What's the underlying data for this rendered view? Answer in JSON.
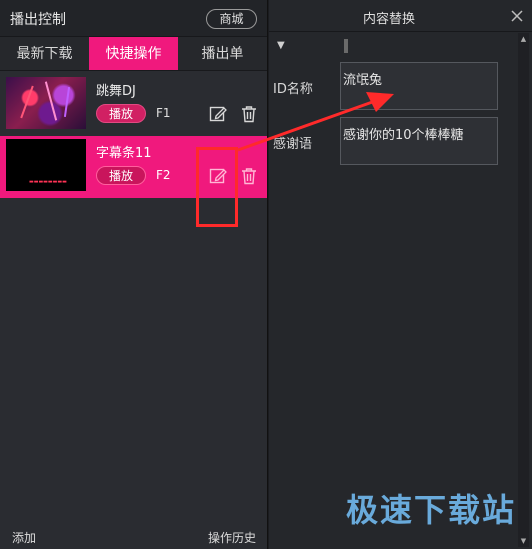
{
  "left_panel": {
    "title": "播出控制",
    "shop_label": "商城",
    "tabs": [
      {
        "label": "最新下载",
        "active": false
      },
      {
        "label": "快捷操作",
        "active": true
      },
      {
        "label": "播出单",
        "active": false
      }
    ],
    "items": [
      {
        "name": "跳舞DJ",
        "play_label": "播放",
        "hotkey": "F1",
        "selected": false
      },
      {
        "name": "字幕条11",
        "play_label": "播放",
        "hotkey": "F2",
        "selected": true
      }
    ],
    "footer": {
      "add_label": "添加",
      "history_label": "操作历史"
    }
  },
  "right_panel": {
    "title": "内容替换",
    "collapse_glyph": "▼",
    "fields": [
      {
        "label": "ID名称",
        "value": "流氓兔"
      },
      {
        "label": "感谢语",
        "value": "感谢你的10个棒棒糖"
      }
    ]
  },
  "watermark": "极速下载站",
  "colors": {
    "accent": "#f0197d",
    "annotation": "#ff2a2a",
    "watermark": "#6fb6ea"
  }
}
